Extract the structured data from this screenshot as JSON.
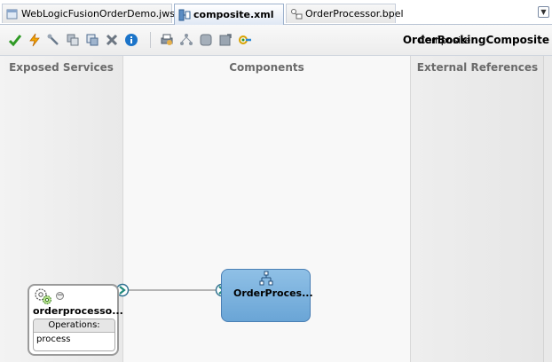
{
  "tabs": [
    {
      "label": "WebLogicFusionOrderDemo.jws",
      "icon": "project-icon",
      "active": false
    },
    {
      "label": "composite.xml",
      "icon": "composite-icon",
      "active": true
    },
    {
      "label": "OrderProcessor.bpel",
      "icon": "bpel-icon",
      "active": false
    }
  ],
  "toolbar": {
    "buttons": [
      "validate-icon",
      "deploy-icon",
      "wrench-icon",
      "copy-icon",
      "paste-icon",
      "delete-icon",
      "info-icon",
      "print-icon",
      "layout-icon",
      "group-icon",
      "refresh-icon",
      "test-icon"
    ],
    "composite_label": "Composite:",
    "composite_name": "OrderBookingComposite"
  },
  "lanes": {
    "exposed_services": "Exposed Services",
    "components": "Components",
    "external_references": "External References"
  },
  "service": {
    "name": "orderprocesso...",
    "operations_label": "Operations:",
    "operations": [
      "process"
    ]
  },
  "component": {
    "name": "OrderProces..."
  },
  "colors": {
    "accent": "#1b74c9",
    "component_fill": "#7db4e0",
    "lane_title": "#6b6b6b"
  }
}
